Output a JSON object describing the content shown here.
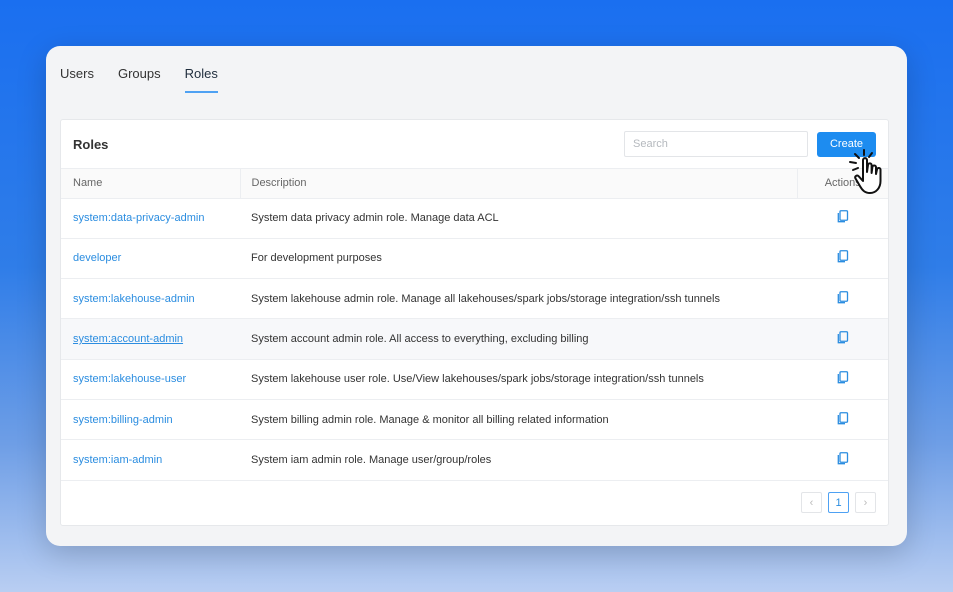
{
  "tabs": [
    {
      "label": "Users"
    },
    {
      "label": "Groups"
    },
    {
      "label": "Roles"
    }
  ],
  "panel": {
    "title": "Roles",
    "search_placeholder": "Search",
    "create_label": "Create"
  },
  "table": {
    "headers": {
      "name": "Name",
      "description": "Description",
      "actions": "Actions"
    },
    "rows": [
      {
        "name": "system:data-privacy-admin",
        "description": "System data privacy admin role. Manage data ACL"
      },
      {
        "name": "developer",
        "description": "For development purposes"
      },
      {
        "name": "system:lakehouse-admin",
        "description": "System lakehouse admin role. Manage all lakehouses/spark jobs/storage integration/ssh tunnels"
      },
      {
        "name": "system:account-admin",
        "description": "System account admin role. All access to everything, excluding billing"
      },
      {
        "name": "system:lakehouse-user",
        "description": "System lakehouse user role. Use/View lakehouses/spark jobs/storage integration/ssh tunnels"
      },
      {
        "name": "system:billing-admin",
        "description": "System billing admin role. Manage & monitor all billing related information"
      },
      {
        "name": "system:iam-admin",
        "description": "System iam admin role. Manage user/group/roles"
      }
    ]
  },
  "pagination": {
    "prev": "‹",
    "current": "1",
    "next": "›"
  },
  "colors": {
    "accent": "#1d8cf0",
    "link": "#2b8de0"
  }
}
